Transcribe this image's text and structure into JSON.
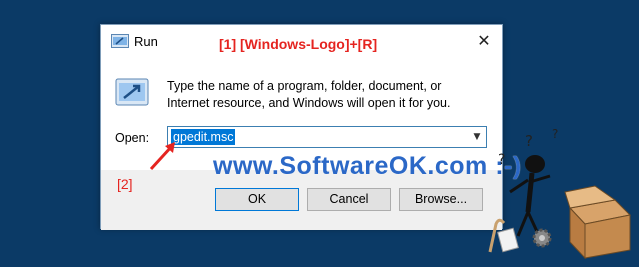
{
  "dialog": {
    "title": "Run",
    "description": "Type the name of a program, folder, document, or Internet resource, and Windows will open it for you.",
    "open_label": "Open:",
    "open_value": "gpedit.msc",
    "buttons": {
      "ok": "OK",
      "cancel": "Cancel",
      "browse": "Browse..."
    }
  },
  "annotations": {
    "shortcut": "[1]  [Windows-Logo]+[R]",
    "marker": "[2]"
  },
  "watermark": "www.SoftwareOK.com :-)",
  "icons": {
    "title_icon": "run-app-icon",
    "dialog_icon": "run-app-icon",
    "close": "close-icon",
    "dropdown": "chevron-down-icon"
  },
  "colors": {
    "desktop": "#0b3a66",
    "annotation": "#e52420",
    "selection": "#0078d7",
    "watermark": "#2b68c7"
  }
}
